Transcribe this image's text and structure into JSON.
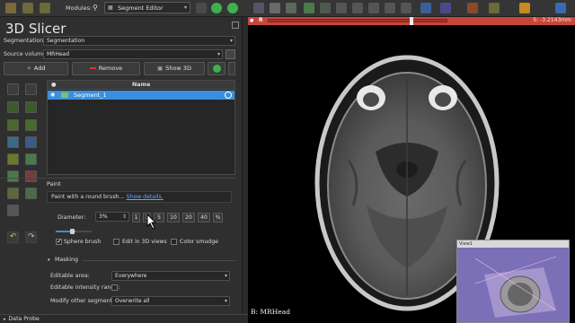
{
  "toolbar": {
    "modules_label": "Modules:",
    "current_module": "Segment Editor"
  },
  "app": {
    "title": "3D Slicer"
  },
  "segmentation": {
    "label": "Segmentation:",
    "value": "Segmentation"
  },
  "source_volume": {
    "label": "Source volume:",
    "value": "MRHead"
  },
  "actions": {
    "add": "Add",
    "remove": "Remove",
    "show3d": "Show 3D"
  },
  "segments_table": {
    "header_name": "Name",
    "rows": [
      {
        "name": "Segment_1",
        "color": "#80c060"
      }
    ]
  },
  "paint": {
    "section_label": "Paint",
    "description": "Paint with a round brush...",
    "details_link": "Show details.",
    "diameter_label": "Diameter:",
    "diameter_value": "3%",
    "presets": [
      "1",
      "3",
      "5",
      "10",
      "20",
      "40",
      "%"
    ],
    "sphere_brush": "Sphere brush",
    "edit_3d": "Edit in 3D views",
    "color_smudge": "Color smudge",
    "sphere_brush_checked": true,
    "edit_3d_checked": false,
    "color_smudge_checked": false,
    "diameter_slider_fraction": 0.1
  },
  "masking": {
    "header": "Masking",
    "editable_area_label": "Editable area:",
    "editable_area_value": "Everywhere",
    "intensity_range_label": "Editable intensity range:",
    "modify_other_label": "Modify other segments:",
    "modify_other_value": "Overwrite all"
  },
  "data_probe": {
    "label": "Data Probe"
  },
  "viewer": {
    "slice_name": "R",
    "offset": "S: -3.2143mm",
    "volume_label": "B: MRHead",
    "inset_title": "View1",
    "accent_red": "#c8453b",
    "inset_bg": "#7b6fb8"
  }
}
